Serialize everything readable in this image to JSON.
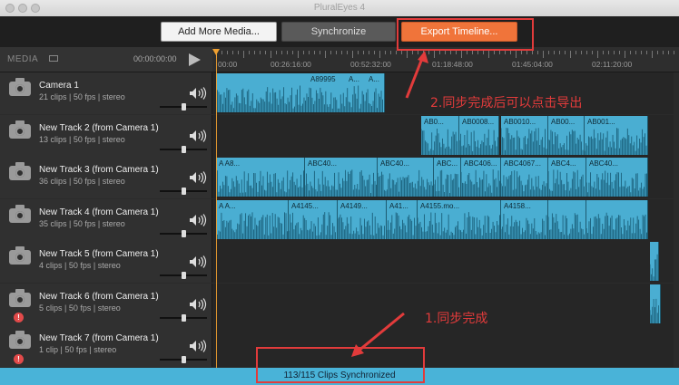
{
  "window": {
    "title": "PluralEyes 4"
  },
  "toolbar": {
    "add_media_label": "Add More Media...",
    "synchronize_label": "Synchronize",
    "export_label": "Export Timeline..."
  },
  "sidebar": {
    "media_label": "MEDIA",
    "timecode": "00:00:00:00"
  },
  "ruler": {
    "labels": [
      "00:00",
      "00:26:16:00",
      "00:52:32:00",
      "01:18:48:00",
      "01:45:04:00",
      "02:11:20:00"
    ]
  },
  "tracks": [
    {
      "name": "Camera 1",
      "meta": "21 clips  |  50 fps  |  stereo",
      "warning": false
    },
    {
      "name": "New Track 2 (from Camera 1)",
      "meta": "13 clips  |  50 fps  |  stereo",
      "warning": false
    },
    {
      "name": "New Track 3 (from Camera 1)",
      "meta": "36 clips  |  50 fps  |  stereo",
      "warning": false
    },
    {
      "name": "New Track 4 (from Camera 1)",
      "meta": "35 clips  |  50 fps  |  stereo",
      "warning": false
    },
    {
      "name": "New Track 5 (from Camera 1)",
      "meta": "4 clips  |  50 fps  |  stereo",
      "warning": false
    },
    {
      "name": "New Track 6 (from Camera 1)",
      "meta": "5 clips  |  50 fps  |  stereo",
      "warning": true,
      "warning_text": "!"
    },
    {
      "name": "New Track 7 (from Camera 1)",
      "meta": "1 clip  |  50 fps  |  stereo",
      "warning": true,
      "warning_text": "!"
    }
  ],
  "clip_labels": {
    "t1": [
      "A89995",
      "A...",
      "A..."
    ],
    "t2": [
      "AB0...",
      "AB0008...",
      "AB0010...",
      "AB00...",
      "AB001..."
    ],
    "t3": [
      "A A8...",
      "ABC40...",
      "ABC40...",
      "ABC...",
      "ABC406...",
      "ABC4067...",
      "ABC4...",
      "ABC40..."
    ],
    "t4": [
      "A A...",
      "A4145...",
      "A4149...",
      "A41...",
      "A4155.mo...",
      "A4158..."
    ]
  },
  "annotations": {
    "export_note": "2.同步完成后可以点击导出",
    "sync_note": "1.同步完成"
  },
  "status": {
    "text": "113/115 Clips Synchronized"
  },
  "colors": {
    "clip": "#4aaed2",
    "export_button": "#f0743a",
    "annotation": "#e23b3b",
    "status_bar": "#49b3d8",
    "playhead": "#f0a030"
  }
}
